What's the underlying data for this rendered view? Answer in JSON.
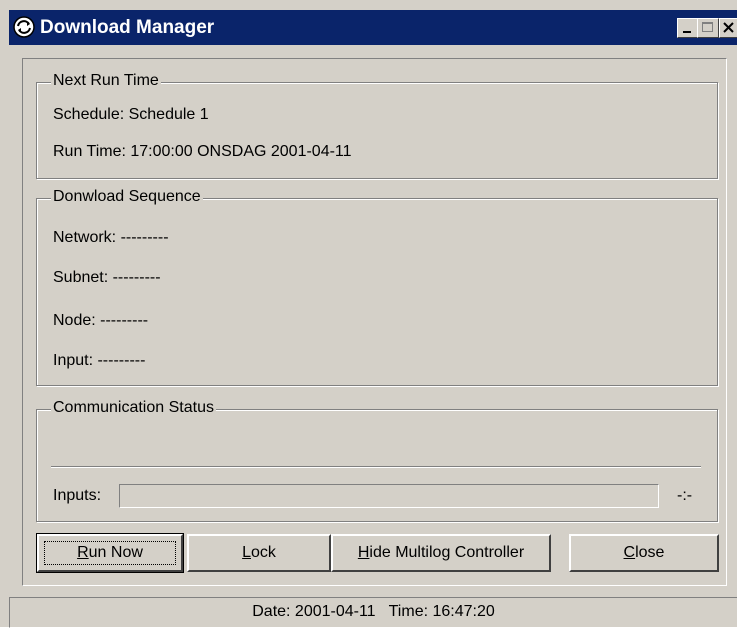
{
  "window": {
    "title": "Download Manager"
  },
  "next_run": {
    "title": "Next Run Time",
    "schedule": "Schedule: Schedule 1",
    "run_time": "Run Time: 17:00:00 ONSDAG 2001-04-11"
  },
  "sequence": {
    "title": "Donwload Sequence",
    "network": "Network: ---------",
    "subnet": "Subnet: ---------",
    "node": "Node: ---------",
    "input": "Input: ---------"
  },
  "comm": {
    "title": "Communication Status",
    "inputs_label": "Inputs:",
    "inputs_value": "-:-",
    "progress": 0
  },
  "buttons": {
    "run_now": {
      "mnemonic": "R",
      "rest": "un Now"
    },
    "lock": {
      "mnemonic": "L",
      "rest": "ock"
    },
    "hide": {
      "mnemonic": "H",
      "rest": "ide Multilog Controller"
    },
    "close": {
      "mnemonic": "C",
      "rest": "lose"
    }
  },
  "status": {
    "text": "Date: 2001-04-11   Time: 16:47:20"
  },
  "colors": {
    "titlebar": "#0a246a",
    "face": "#d4d0c8"
  },
  "icons": {
    "app": "app-sync-icon",
    "minimize": "minimize-icon",
    "maximize": "maximize-icon",
    "close": "close-icon"
  }
}
